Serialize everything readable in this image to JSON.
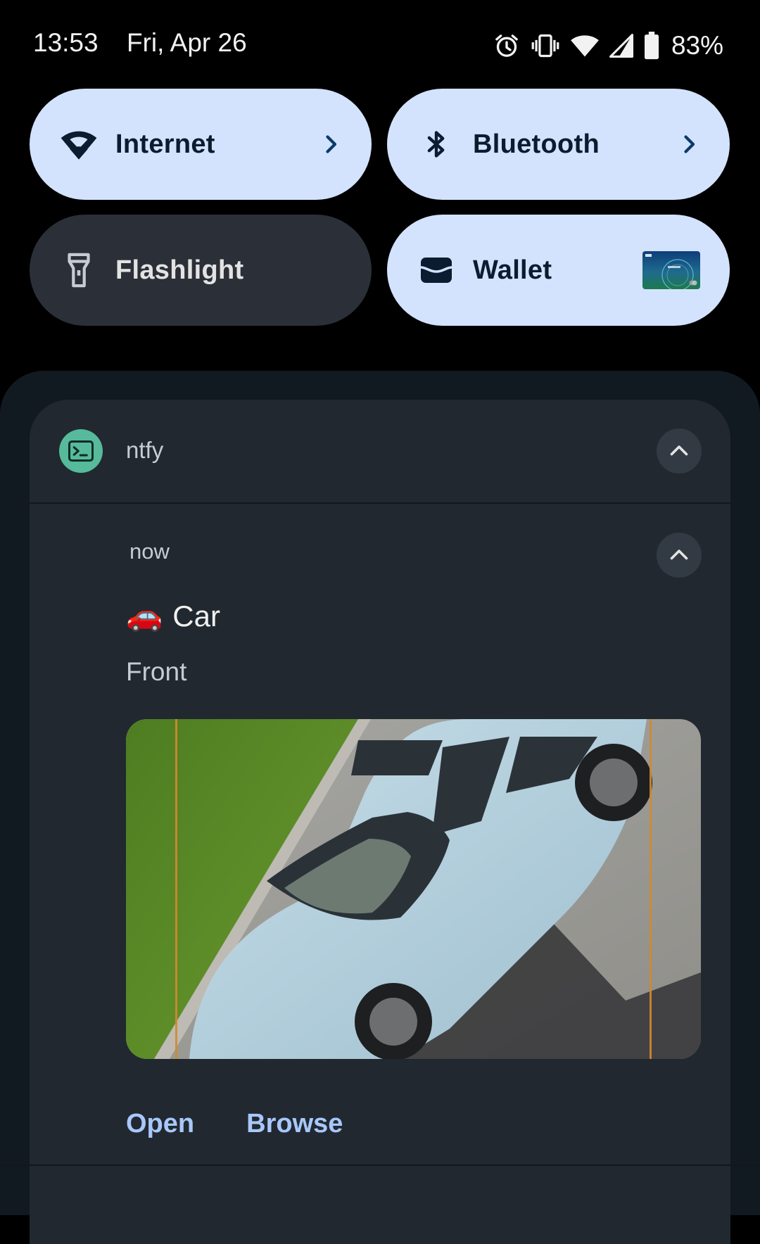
{
  "status_bar": {
    "time": "13:53",
    "date": "Fri, Apr 26",
    "battery": "83%",
    "icons": [
      "alarm-icon",
      "vibrate-icon",
      "wifi-icon",
      "cell-signal-icon",
      "battery-icon"
    ]
  },
  "tiles": {
    "internet": {
      "label": "Internet",
      "icon": "wifi-icon",
      "state": "on"
    },
    "bluetooth": {
      "label": "Bluetooth",
      "icon": "bluetooth-icon",
      "state": "on"
    },
    "flashlight": {
      "label": "Flashlight",
      "icon": "flashlight-icon",
      "state": "off"
    },
    "wallet": {
      "label": "Wallet",
      "icon": "wallet-icon",
      "state": "on"
    }
  },
  "notification": {
    "app_name": "ntfy",
    "time": "now",
    "title_emoji": "🚗",
    "title": "Car",
    "text": "Front",
    "image": "car-photo",
    "actions": {
      "open": "Open",
      "browse": "Browse"
    }
  },
  "colors": {
    "tile_on": "#d3e3fd",
    "tile_off": "#2b3038",
    "app_icon": "#56ba9b",
    "action": "#a8c7fa",
    "card": "#212830"
  }
}
